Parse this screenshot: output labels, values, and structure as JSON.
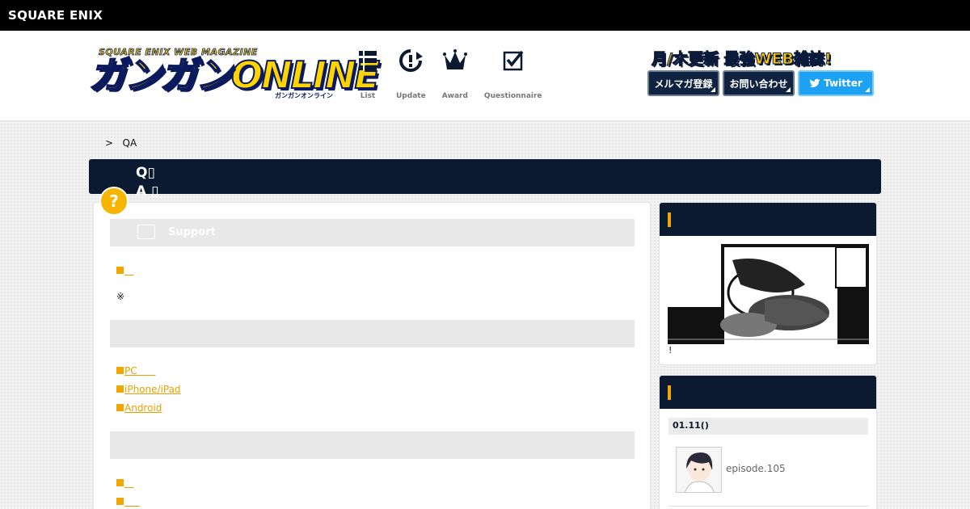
{
  "topbar": {
    "brand": "SQUARE ENIX"
  },
  "logo": {
    "subtitle": "SQUARE ENIX WEB MAGAZINE",
    "main": "ガンガンONLINE",
    "tiny": "ガンガンオンライン"
  },
  "nav": [
    {
      "label": "List",
      "icon": "list-icon"
    },
    {
      "label": "Update",
      "icon": "update-icon"
    },
    {
      "label": "Award",
      "icon": "crown-icon"
    },
    {
      "label": "Questionnaire",
      "icon": "checkbox-icon"
    }
  ],
  "header": {
    "catchphrase": "月/木更新 最強WEB雑誌!",
    "buttons": {
      "mailmag": "メルマガ登録",
      "contact": "お問い合わせ",
      "twitter": "Twitter"
    }
  },
  "breadcrumb": {
    "sep": ">",
    "current": "QA"
  },
  "title": {
    "q": "Q▯",
    "a": "A ▯"
  },
  "badge": "?",
  "main": {
    "sections": [
      {
        "label": "Support",
        "icon": "support-icon"
      },
      {
        "label": ""
      },
      {
        "label": ""
      }
    ],
    "links": {
      "l1": "   ",
      "pc": "PC      ",
      "iphone": "iPhone/iPad",
      "android": "Android",
      "l5": "   ",
      "l6": "     "
    },
    "note": "※"
  },
  "sidebar": {
    "widget1": {
      "caption": "!"
    },
    "widget2": {
      "date": "01.11()",
      "episode": "episode.105"
    }
  },
  "colors": {
    "navy": "#0b1a30",
    "accent": "#f0a800",
    "twitter": "#1da1f2",
    "logo_yellow": "#ffd400"
  }
}
